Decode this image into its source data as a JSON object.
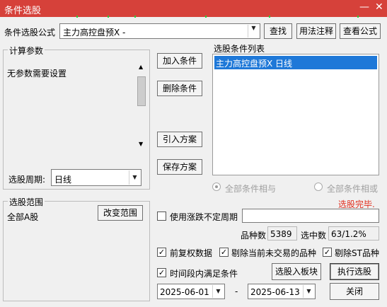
{
  "window": {
    "title": "条件选股",
    "close_icon": "close-icon"
  },
  "formula_row": {
    "label": "条件选股公式",
    "selected_formula": "主力高控盘预X -",
    "find_button": "查找",
    "usage_button": "用法注释",
    "view_formula_button": "查看公式"
  },
  "calc_params": {
    "title": "计算参数",
    "message": "无参数需要设置",
    "period_label": "选股周期:",
    "period_value": "日线"
  },
  "condition_buttons": {
    "add": "加入条件",
    "delete": "删除条件",
    "import": "引入方案",
    "save": "保存方案"
  },
  "condition_list": {
    "title": "选股条件列表",
    "items": [
      "主力高控盘预X  日线"
    ]
  },
  "logic": {
    "all_and": "全部条件相与",
    "all_or": "全部条件相或",
    "selected": "all_and"
  },
  "status": {
    "text": "选股完毕.",
    "color": "#e03020"
  },
  "range": {
    "title": "选股范围",
    "value": "全部A股",
    "change_button": "改变范围"
  },
  "unfixed_period": {
    "label": "使用涨跌不定周期",
    "checked": false,
    "value": ""
  },
  "stats": {
    "count_label": "品种数",
    "count_value": "5389",
    "selected_label": "选中数",
    "selected_value": "63/1.2%"
  },
  "options": {
    "forward_adjust": {
      "label": "前复权数据",
      "checked": true
    },
    "exclude_untraded": {
      "label": "剔除当前未交易的品种",
      "checked": true
    },
    "exclude_st": {
      "label": "剔除ST品种",
      "checked": true
    },
    "time_range": {
      "label": "时间段内满足条件",
      "checked": true
    }
  },
  "actions": {
    "to_block": "选股入板块",
    "execute": "执行选股",
    "close": "关闭"
  },
  "dates": {
    "start": "2025-06-01",
    "separator": "-",
    "end": "2025-06-13"
  }
}
